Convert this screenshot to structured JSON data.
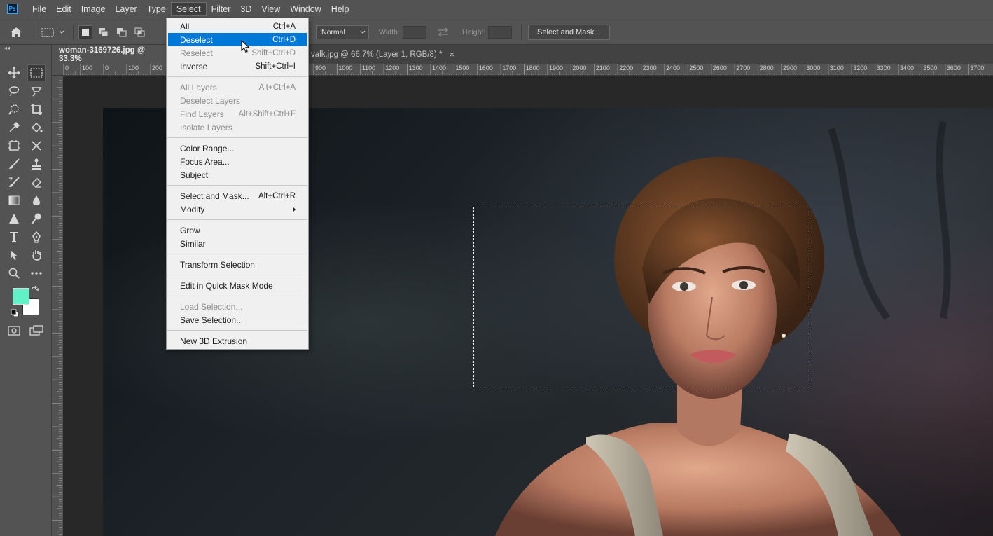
{
  "app": {
    "logo_text": "Ps"
  },
  "menubar": {
    "items": [
      "File",
      "Edit",
      "Image",
      "Layer",
      "Type",
      "Select",
      "Filter",
      "3D",
      "View",
      "Window",
      "Help"
    ],
    "active_index": 5
  },
  "options": {
    "style_value": "Normal",
    "width_label": "Width:",
    "height_label": "Height:",
    "select_and_mask_label": "Select and Mask..."
  },
  "tabs": [
    {
      "label": "woman-3169726.jpg @ 33.3%",
      "active": true
    },
    {
      "label": "valk.jpg @ 66.7% (Layer 1, RGB/8) *",
      "active": false
    }
  ],
  "ruler": {
    "h_labels": [
      "0",
      "100",
      "0",
      "100",
      "200",
      "900",
      "1000",
      "1100",
      "1200",
      "1300",
      "1400",
      "1500",
      "1600",
      "1700",
      "1800",
      "1900",
      "2000",
      "2100",
      "2200",
      "2300",
      "2400",
      "2500",
      "2600",
      "2700",
      "2800",
      "2900",
      "3000",
      "3100",
      "3200",
      "3300",
      "3400",
      "3500",
      "3600",
      "3700"
    ]
  },
  "colors": {
    "foreground": "#60f2c6",
    "background": "#ffffff",
    "highlight": "#0078d7"
  },
  "select_menu": {
    "items": [
      {
        "label": "All",
        "shortcut": "Ctrl+A",
        "disabled": false
      },
      {
        "label": "Deselect",
        "shortcut": "Ctrl+D",
        "disabled": false,
        "highlighted": true
      },
      {
        "label": "Reselect",
        "shortcut": "Shift+Ctrl+D",
        "disabled": true
      },
      {
        "label": "Inverse",
        "shortcut": "Shift+Ctrl+I",
        "disabled": false
      },
      {
        "label": "All Layers",
        "shortcut": "Alt+Ctrl+A",
        "disabled": true
      },
      {
        "label": "Deselect Layers",
        "shortcut": "",
        "disabled": true
      },
      {
        "label": "Find Layers",
        "shortcut": "Alt+Shift+Ctrl+F",
        "disabled": true
      },
      {
        "label": "Isolate Layers",
        "shortcut": "",
        "disabled": true
      },
      {
        "label": "Color Range...",
        "shortcut": "",
        "disabled": false
      },
      {
        "label": "Focus Area...",
        "shortcut": "",
        "disabled": false
      },
      {
        "label": "Subject",
        "shortcut": "",
        "disabled": false
      },
      {
        "label": "Select and Mask...",
        "shortcut": "Alt+Ctrl+R",
        "disabled": false
      },
      {
        "label": "Modify",
        "shortcut": "",
        "disabled": false,
        "submenu": true
      },
      {
        "label": "Grow",
        "shortcut": "",
        "disabled": false
      },
      {
        "label": "Similar",
        "shortcut": "",
        "disabled": false
      },
      {
        "label": "Transform Selection",
        "shortcut": "",
        "disabled": false
      },
      {
        "label": "Edit in Quick Mask Mode",
        "shortcut": "",
        "disabled": false
      },
      {
        "label": "Load Selection...",
        "shortcut": "",
        "disabled": true
      },
      {
        "label": "Save Selection...",
        "shortcut": "",
        "disabled": false
      },
      {
        "label": "New 3D Extrusion",
        "shortcut": "",
        "disabled": false
      }
    ]
  }
}
